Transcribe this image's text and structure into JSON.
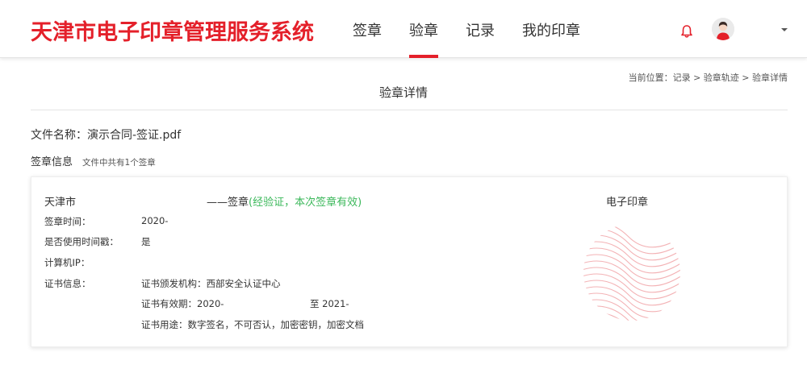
{
  "header": {
    "logo": "天津市电子印章管理服务系统",
    "nav": [
      "签章",
      "验章",
      "记录",
      "我的印章"
    ],
    "active_nav": 1
  },
  "breadcrumb": "当前位置：记录 > 验章轨迹 > 验章详情",
  "page_title": "验章详情",
  "file": {
    "label": "文件名称：",
    "name": "演示合同-签证.pdf"
  },
  "signature_info": {
    "title": "签章信息",
    "subtitle": "文件中共有1个签章"
  },
  "card": {
    "signer": "天津市",
    "sig_dash": "——签章",
    "status": "(经验证，本次签章有效)",
    "seal_label": "电子印章",
    "rows": [
      {
        "label": "签章时间：",
        "value": "2020-"
      },
      {
        "label": "是否使用时间戳：",
        "value": "是"
      },
      {
        "label": "计算机IP：",
        "value": ""
      },
      {
        "label": "证书信息：",
        "value": "证书颁发机构：西部安全认证中心"
      }
    ],
    "validity": {
      "from": "证书有效期：2020-",
      "to": "至 2021-"
    },
    "usage": "证书用途：数字签名，不可否认，加密密钥，加密文档"
  },
  "colors": {
    "brand": "#e4202a",
    "valid": "#3cb85b"
  },
  "icons": [
    "bell-icon",
    "avatar",
    "chevron-down-icon",
    "seal-watermark"
  ]
}
